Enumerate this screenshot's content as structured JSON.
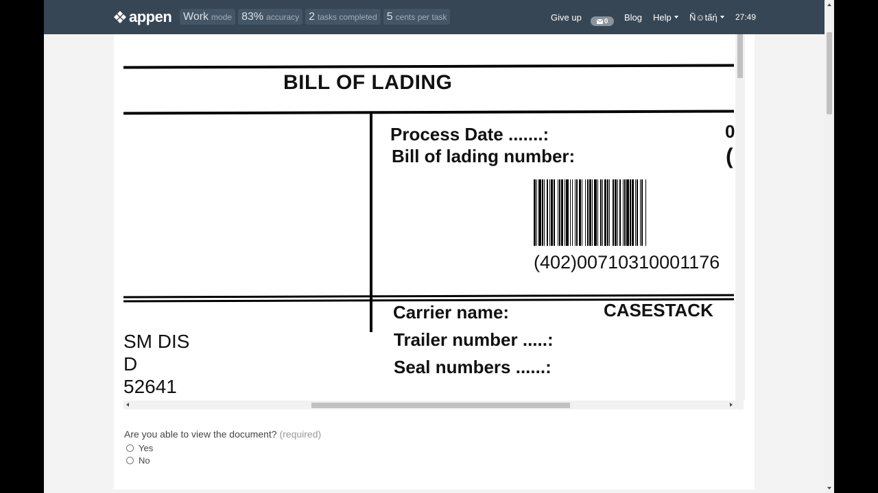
{
  "colors": {
    "navbar": "#374655",
    "stat_pill": "#445566",
    "page_bg": "#f3f3f3",
    "card": "#ffffff"
  },
  "navbar": {
    "logo_text": "appen",
    "stats": [
      {
        "value": "Work",
        "label": "mode"
      },
      {
        "value": "83%",
        "label": "accuracy"
      },
      {
        "value": "2",
        "label": "tasks completed"
      },
      {
        "value": "5",
        "label": "cents per task"
      }
    ],
    "give_up_label": "Give up",
    "message_count": "0",
    "blog_label": "Blog",
    "help_label": "Help",
    "user_label": "Ñ☺tấή",
    "timer": "27:49"
  },
  "document": {
    "title": "BILL OF LADING",
    "process_date_label": "Process Date .......:",
    "process_date_value": "0",
    "bol_number_label": "Bill of lading number:",
    "bol_number_value": "(",
    "barcode_text": "(402)00710310001176",
    "carrier_label": "Carrier name:",
    "carrier_value": "CASESTACK",
    "trailer_label": "Trailer number .....:",
    "seal_label": "Seal numbers ......:",
    "address_line1": "SM DIS",
    "address_line2": "D",
    "address_line3": "52641"
  },
  "question": {
    "text": "Are you able to view the document?",
    "required_label": "(required)",
    "options": [
      "Yes",
      "No"
    ]
  }
}
